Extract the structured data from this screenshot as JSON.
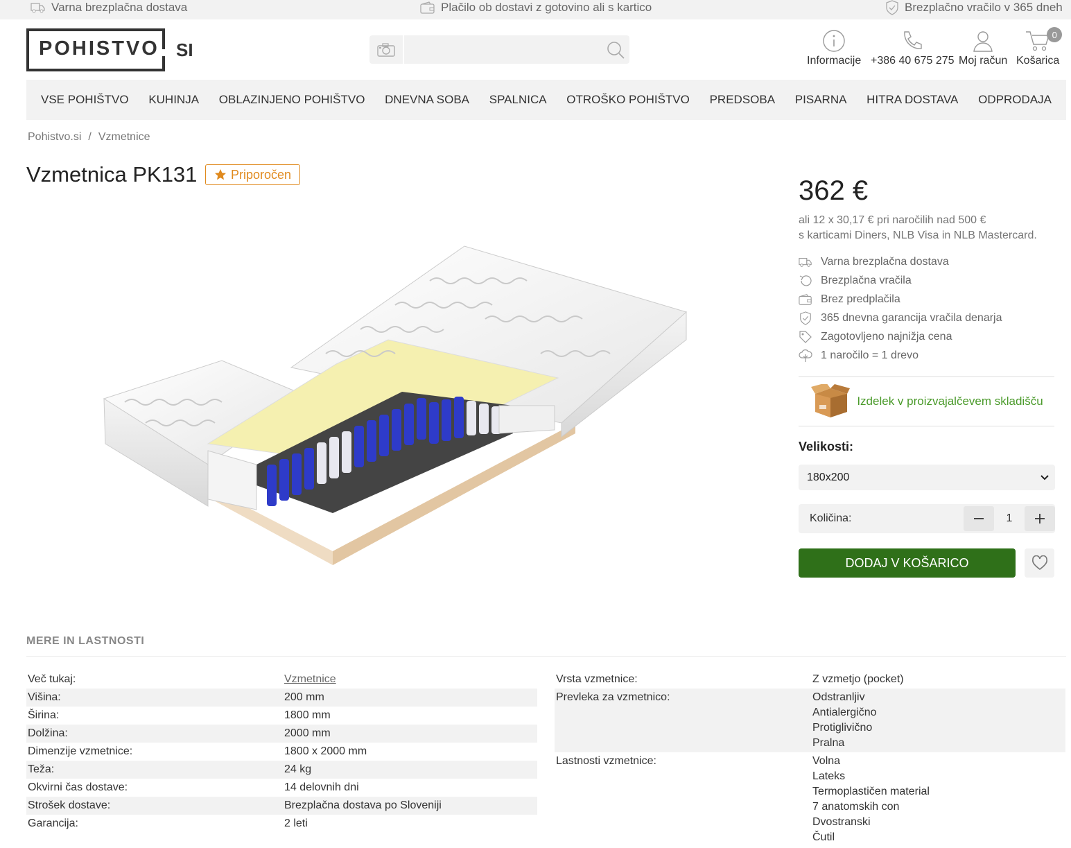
{
  "topbar": {
    "shipping": "Varna brezplačna dostava",
    "payment": "Plačilo ob dostavi z gotovino ali s kartico",
    "returns": "Brezplačno vračilo v 365 dneh"
  },
  "logo": {
    "main": "POHISTVO",
    "suffix": "SI"
  },
  "search": {
    "value": "",
    "placeholder": ""
  },
  "header": {
    "info": "Informacije",
    "phone": "+386 40 675 275",
    "account": "Moj račun",
    "cart": "Košarica",
    "cart_count": "0"
  },
  "nav": [
    "Vse pohištvo",
    "Kuhinja",
    "Oblazinjeno pohištvo",
    "Dnevna soba",
    "Spalnica",
    "Otroško pohištvo",
    "Predsoba",
    "Pisarna",
    "Hitra dostava",
    "Odprodaja"
  ],
  "breadcrumb": {
    "home": "Pohistvo.si",
    "sep": "/",
    "current": "Vzmetnice"
  },
  "product": {
    "title": "Vzmetnica PK131",
    "badge": "Priporočen",
    "price": "362 €",
    "installment_line1": "ali 12 x 30,17 € pri naročilih nad 500 €",
    "installment_line2": "s karticami Diners, NLB Visa in NLB Mastercard.",
    "perks": [
      {
        "icon": "truck-icon",
        "text": "Varna brezplačna dostava"
      },
      {
        "icon": "return-icon",
        "text": "Brezplačna vračila"
      },
      {
        "icon": "wallet-icon",
        "text": "Brez predplačila"
      },
      {
        "icon": "shield-icon",
        "text": "365 dnevna garancija vračila denarja"
      },
      {
        "icon": "tag-icon",
        "text": "Zagotovljeno najnižja cena"
      },
      {
        "icon": "tree-icon",
        "text": "1 naročilo = 1 drevo"
      }
    ],
    "stock": "Izdelek v proizvajalčevem skladišču",
    "sizes_label": "Velikosti:",
    "size_selected": "180x200",
    "qty_label": "Količina:",
    "qty_value": "1",
    "add_to_cart": "Dodaj v košarico"
  },
  "specs": {
    "heading": "MERE IN LASTNOSTI",
    "left": [
      {
        "k": "Več tukaj:",
        "v": [
          "Vzmetnice"
        ],
        "link": true
      },
      {
        "k": "Višina:",
        "v": [
          "200 mm"
        ]
      },
      {
        "k": "Širina:",
        "v": [
          "1800 mm"
        ]
      },
      {
        "k": "Dolžina:",
        "v": [
          "2000 mm"
        ]
      },
      {
        "k": "Dimenzije vzmetnice:",
        "v": [
          "1800 x 2000 mm"
        ]
      },
      {
        "k": "Teža:",
        "v": [
          "24 kg"
        ]
      },
      {
        "k": "Okvirni čas dostave:",
        "v": [
          "14 delovnih dni"
        ]
      },
      {
        "k": "Strošek dostave:",
        "v": [
          "Brezplačna dostava po Sloveniji"
        ]
      },
      {
        "k": "Garancija:",
        "v": [
          "2 leti"
        ]
      }
    ],
    "right": [
      {
        "k": "Vrsta vzmetnice:",
        "v": [
          "Z vzmetjo (pocket)"
        ]
      },
      {
        "k": "Prevleka za vzmetnico:",
        "v": [
          "Odstranljiv",
          "Antialergično",
          "Protiglivično",
          "Pralna"
        ]
      },
      {
        "k": "Lastnosti vzmetnice:",
        "v": [
          "Volna",
          "Lateks",
          "Termoplastičen material",
          "7 anatomskih con",
          "Dvostranski",
          "Čutil"
        ]
      }
    ]
  }
}
